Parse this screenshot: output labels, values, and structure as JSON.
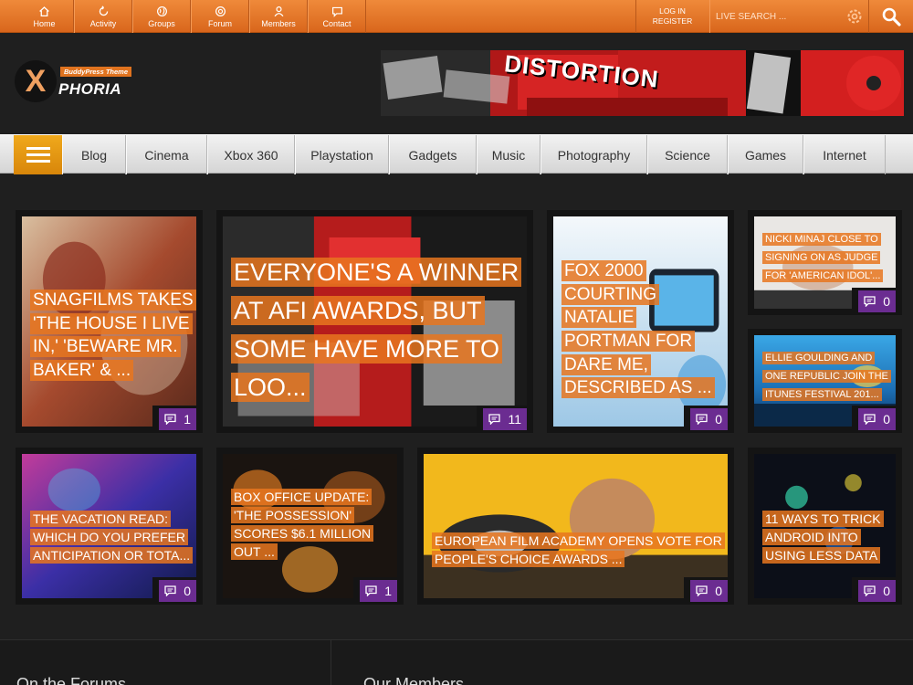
{
  "topnav": [
    {
      "label": "Home",
      "icon": "home-icon"
    },
    {
      "label": "Activity",
      "icon": "activity-icon"
    },
    {
      "label": "Groups",
      "icon": "globe-icon"
    },
    {
      "label": "Forum",
      "icon": "forum-icon"
    },
    {
      "label": "Members",
      "icon": "members-icon"
    },
    {
      "label": "Contact",
      "icon": "contact-icon"
    }
  ],
  "auth": {
    "login": "LOG IN",
    "register": "REGISTER"
  },
  "search": {
    "placeholder": "LIVE SEARCH ..."
  },
  "logo": {
    "letter": "X",
    "tag": "BuddyPress Theme",
    "name": "PHORIA"
  },
  "banner": {
    "text": "DISTORTION"
  },
  "categories": [
    "Blog",
    "Cinema",
    "Xbox 360",
    "Playstation",
    "Gadgets",
    "Music",
    "Photography",
    "Science",
    "Games",
    "Internet"
  ],
  "posts": [
    {
      "title": "SNAGFILMS TAKES 'THE HOUSE I LIVE IN,' 'BEWARE MR. BAKER' & ...",
      "comments": "1"
    },
    {
      "title": "EVERYONE'S A WINNER AT AFI AWARDS, BUT SOME HAVE MORE TO LOO...",
      "comments": "11"
    },
    {
      "title": "FOX 2000 COURTING NATALIE PORTMAN FOR DARE ME, DESCRIBED AS ...",
      "comments": "0"
    },
    {
      "title": "NICKI MINAJ CLOSE TO SIGNING ON AS JUDGE FOR 'AMERICAN IDOL'...",
      "comments": "0"
    },
    {
      "title": "ELLIE GOULDING AND ONE REPUBLIC JOIN THE ITUNES FESTIVAL 201...",
      "comments": "0"
    },
    {
      "title": "THE VACATION READ: WHICH DO YOU PREFER ANTICIPATION OR TOTA...",
      "comments": "0"
    },
    {
      "title": "BOX OFFICE UPDATE: 'THE POSSESSION' SCORES $6.1 MILLION OUT ...",
      "comments": "1"
    },
    {
      "title": "EUROPEAN FILM ACADEMY OPENS VOTE FOR PEOPLE'S CHOICE AWARDS ...",
      "comments": "0"
    },
    {
      "title": "11 WAYS TO TRICK ANDROID INTO USING LESS DATA",
      "comments": "0"
    }
  ],
  "footer": {
    "left_heading": "On the Forums",
    "right_heading": "Our Members"
  },
  "colors": {
    "accent": "#e0731f",
    "comment_badge": "#6b2c91",
    "menu_button": "#f0a91c",
    "background": "#1f1f1f"
  }
}
